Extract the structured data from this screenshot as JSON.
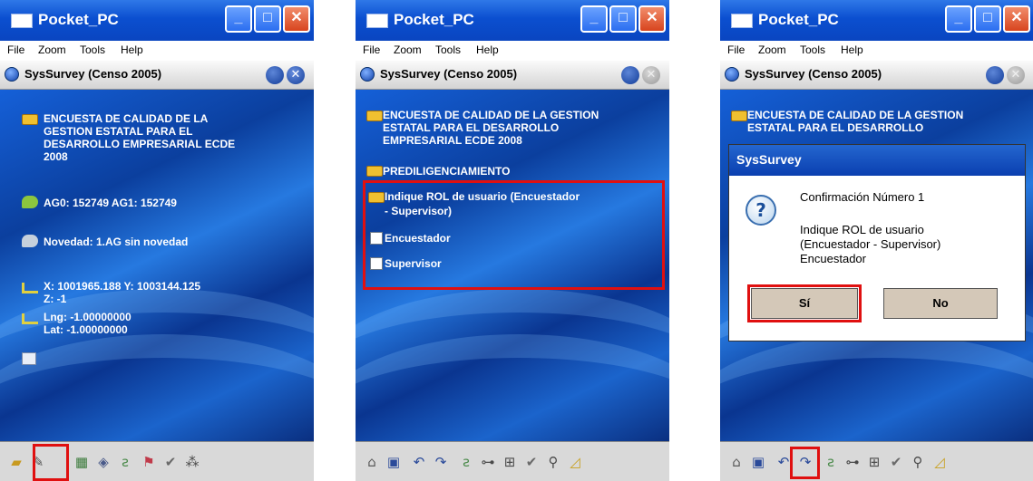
{
  "accent_colors": {
    "title_bar": "#0b4fd0",
    "highlight": "#e01010",
    "background": "#0a3a8c"
  },
  "screens": [
    {
      "window": {
        "title": "Pocket_PC",
        "min_btn": "_",
        "max_btn": "□",
        "close_btn": "✕"
      },
      "menu": [
        "File",
        "Zoom",
        "Tools",
        "Help"
      ],
      "app": {
        "title": "SysSurvey  (Censo 2005)",
        "close_glyph": "✕"
      },
      "lines": [
        "ENCUESTA DE CALIDAD DE LA",
        "GESTION ESTATAL PARA EL",
        "DESARROLLO  EMPRESARIAL ECDE",
        "2008",
        "AG0: 152749   AG1: 152749",
        "Novedad:  1.AG sin novedad",
        "X: 1001965.188   Y: 1003144.125",
        "Z: -1",
        "Lng: -1.00000000",
        "Lat: -1.00000000"
      ],
      "toolbar_icons": [
        "folder-icon",
        "edit-icon",
        "map-icon",
        "gps-icon",
        "signal-icon",
        "flag-icon",
        "check-icon",
        "tree-icon"
      ]
    },
    {
      "window": {
        "title": "Pocket_PC",
        "min_btn": "_",
        "max_btn": "□",
        "close_btn": "✕"
      },
      "menu": [
        "File",
        "Zoom",
        "Tools",
        "Help"
      ],
      "app": {
        "title": "SysSurvey  (Censo 2005)",
        "close_glyph": "✕"
      },
      "lines": [
        "ENCUESTA DE CALIDAD DE LA GESTION",
        "ESTATAL PARA EL DESARROLLO",
        "EMPRESARIAL ECDE 2008",
        "PREDILIGENCIAMIENTO",
        "Indique ROL de usuario (Encuestador",
        "- Supervisor)",
        "Encuestador",
        "Supervisor"
      ],
      "toolbar_icons": [
        "home-icon",
        "save-icon",
        "undo-icon",
        "redo-icon",
        "signal-icon",
        "network-icon",
        "grid-icon",
        "check-icon",
        "search-icon",
        "chart-icon"
      ]
    },
    {
      "window": {
        "title": "Pocket_PC",
        "min_btn": "_",
        "max_btn": "□",
        "close_btn": "✕"
      },
      "menu": [
        "File",
        "Zoom",
        "Tools",
        "Help"
      ],
      "app": {
        "title": "SysSurvey  (Censo 2005)",
        "close_glyph": "✕"
      },
      "lines": [
        "ENCUESTA DE CALIDAD DE LA GESTION",
        "ESTATAL PARA EL DESARROLLO"
      ],
      "dialog": {
        "title": "SysSurvey",
        "icon": "?",
        "heading": "Confirmación Número 1",
        "body_lines": [
          "Indique ROL de usuario",
          "(Encuestador - Supervisor)",
          "Encuestador"
        ],
        "yes_label": "Sí",
        "no_label": "No"
      },
      "toolbar_icons": [
        "home-icon",
        "save-icon",
        "undo-icon",
        "redo-icon",
        "signal-icon",
        "network-icon",
        "grid-icon",
        "check-icon",
        "search-icon",
        "chart-icon"
      ]
    }
  ]
}
